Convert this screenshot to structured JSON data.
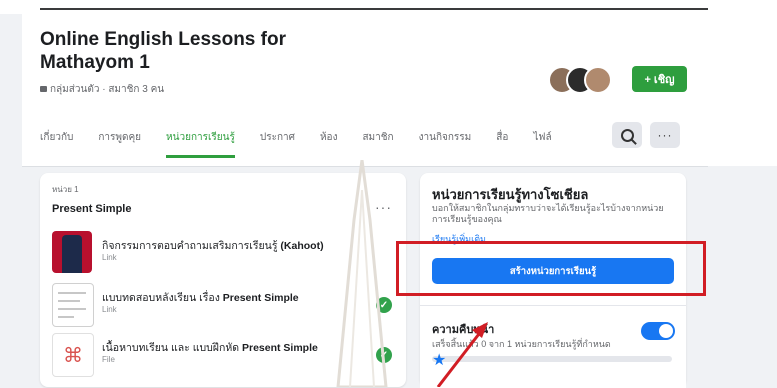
{
  "group": {
    "name": "Online English Lessons for Mathayom 1",
    "meta": "กลุ่มส่วนตัว · สมาชิก 3 คน",
    "join_label": "+ เชิญ"
  },
  "tabs": [
    {
      "label": "เกี่ยวกับ",
      "active": false
    },
    {
      "label": "การพูดคุย",
      "active": false
    },
    {
      "label": "หน่วยการเรียนรู้",
      "active": true
    },
    {
      "label": "ประกาศ",
      "active": false
    },
    {
      "label": "ห้อง",
      "active": false
    },
    {
      "label": "สมาชิก",
      "active": false
    },
    {
      "label": "งานกิจกรรม",
      "active": false
    },
    {
      "label": "สื่อ",
      "active": false
    },
    {
      "label": "ไฟล์",
      "active": false
    }
  ],
  "unit": {
    "label": "หน่วย 1",
    "title": "Present Simple",
    "items": [
      {
        "title_prefix": "กิจกรรมการตอบคำถามเสริมการเรียนรู้ ",
        "title_bold": "(Kahoot)",
        "type": "Link",
        "done": false
      },
      {
        "title_prefix": "แบบทดสอบหลังเรียน เรื่อง ",
        "title_bold": "Present Simple",
        "type": "Link",
        "done": true
      },
      {
        "title_prefix": "เนื้อหาบทเรียน และ แบบฝึกหัด ",
        "title_bold": "Present Simple",
        "type": "File",
        "done": true
      }
    ]
  },
  "social_learning": {
    "title": "หน่วยการเรียนรู้ทางโซเชียล",
    "description": "บอกให้สมาชิกในกลุ่มทราบว่าจะได้เรียนรู้อะไรบ้างจากหน่วยการเรียนรู้ของคุณ",
    "link": "เรียนรู้เพิ่มเติม",
    "create_button": "สร้างหน่วยการเรียนรู้"
  },
  "progress": {
    "title": "ความคืบหน้า",
    "description": "เสร็จสิ้นแล้ว 0 จาก 1 หน่วยการเรียนรู้ที่กำหนด",
    "fraction": 0.0
  },
  "colors": {
    "accent_green": "#2e9e3e",
    "facebook_blue": "#1877f2",
    "annotation_red": "#d11d24"
  }
}
